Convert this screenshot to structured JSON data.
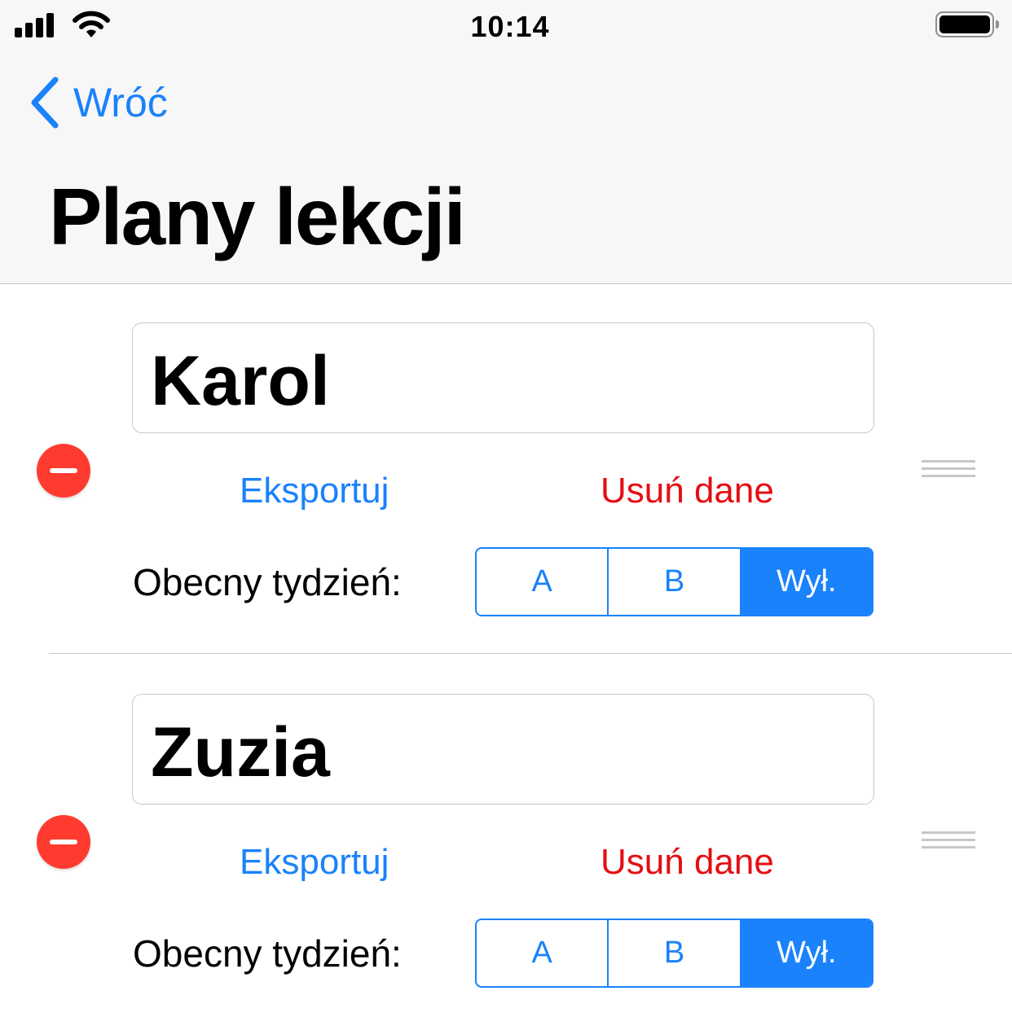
{
  "status_bar": {
    "time": "10:14"
  },
  "nav": {
    "back_label": "Wróć",
    "title": "Plany lekcji"
  },
  "colors": {
    "accent": "#1a82fb",
    "destructive": "#e50e12",
    "delete_control": "#ff3b30"
  },
  "schedules": [
    {
      "name": "Karol",
      "export_label": "Eksportuj",
      "delete_data_label": "Usuń dane",
      "week_label": "Obecny tydzień:",
      "week_options": [
        "A",
        "B",
        "Wył."
      ],
      "selected_option": "Wył."
    },
    {
      "name": "Zuzia",
      "export_label": "Eksportuj",
      "delete_data_label": "Usuń dane",
      "week_label": "Obecny tydzień:",
      "week_options": [
        "A",
        "B",
        "Wył."
      ],
      "selected_option": "Wył."
    }
  ]
}
